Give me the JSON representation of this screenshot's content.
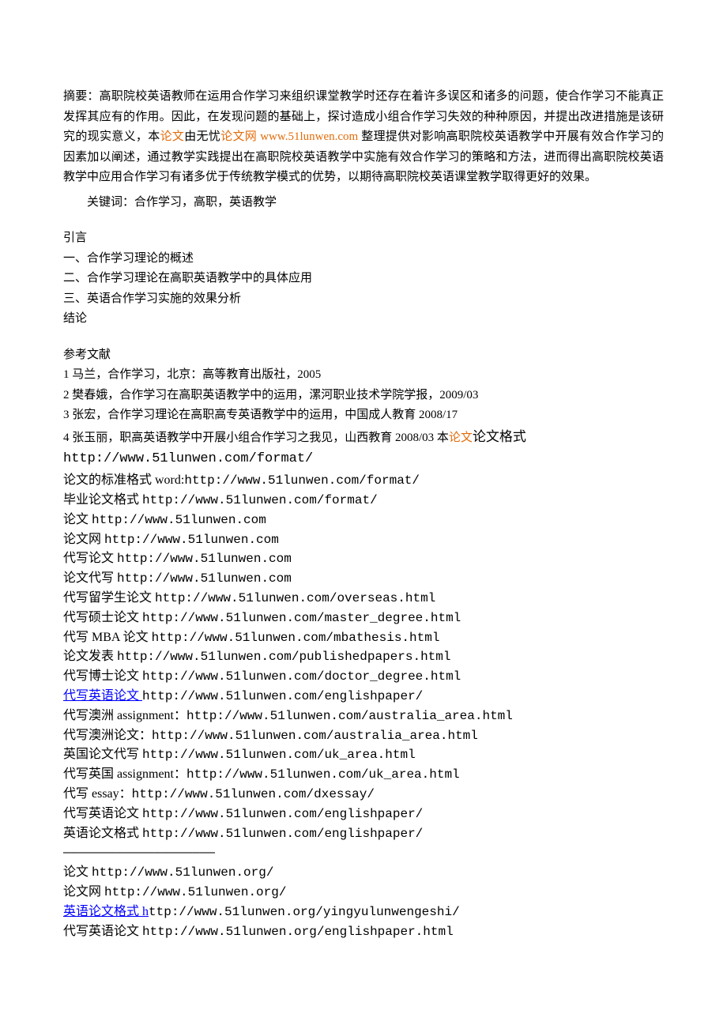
{
  "abstract": {
    "prefix": "  摘要：高职院校英语教师在运用合作学习来组织课堂教学时还存在着许多误区和诸多的问题，使合作学习不能真正发挥其应有的作用。因此，在发现问题的基础上，探讨造成小组合作学习失效的种种原因，并提出改进措施是该研究的现实意义，本",
    "link1": "论文",
    "mid1": "由无忧",
    "link2": "论文网 www.51lunwen.com ",
    "suffix": "整理提供对影响高职院校英语教学中开展有效合作学习的因素加以阐述，通过教学实践提出在高职院校英语教学中实施有效合作学习的策略和方法，进而得出高职院校英语教学中应用合作学习有诸多优于传统教学模式的优势，以期待高职院校英语课堂教学取得更好的效果。"
  },
  "keywords": "关键词：合作学习，高职，英语教学",
  "outline": {
    "l1": "引言",
    "l2": "一、合作学习理论的概述",
    "l3": "二、合作学习理论在高职英语教学中的具体应用",
    "l4": "三、英语合作学习实施的效果分析",
    "l5": "结论"
  },
  "refs_header": "参考文献",
  "refs": {
    "r1": "1 马兰，合作学习，北京：高等教育出版社，2005",
    "r2": "2 樊春娥，合作学习在高职英语教学中的运用，漯河职业技术学院学报，2009/03",
    "r3": "3 张宏，合作学习理论在高职高专英语教学中的运用，中国成人教育  2008/17",
    "r4p": "4 张玉丽，职高英语教学中开展小组合作学习之我见，山西教育  2008/03 本",
    "r4link": "论文",
    "r4suffix": "论文格式",
    "r4url": "http://www.51lunwen.com/format/"
  },
  "links": {
    "l1a": "论文的标准格式 word:",
    "l1b": "http://www.51lunwen.com/format/",
    "l2a": "毕业论文格式 ",
    "l2b": "http://www.51lunwen.com/format/",
    "l3a": "论文 ",
    "l3b": "http://www.51lunwen.com",
    "l4a": "论文网 ",
    "l4b": "http://www.51lunwen.com",
    "l5a": "代写论文 ",
    "l5b": "http://www.51lunwen.com",
    "l6a": "论文代写 ",
    "l6b": "http://www.51lunwen.com",
    "l7a": "代写留学生论文 ",
    "l7b": "http://www.51lunwen.com/overseas.html",
    "l8a": "代写硕士论文 ",
    "l8b": "http://www.51lunwen.com/master_degree.html",
    "l9a": "代写 MBA 论文 ",
    "l9b": "http://www.51lunwen.com/mbathesis.html",
    "l10a": "论文发表 ",
    "l10b": "http://www.51lunwen.com/publishedpapers.html",
    "l11a": "代写博士论文 ",
    "l11b": "http://www.51lunwen.com/doctor_degree.html",
    "l12a": "代写英语论文 ",
    "l12b": "http://www.51lunwen.com/englishpaper/",
    "l13a": "代写澳洲 assignment：",
    "l13b": "http://www.51lunwen.com/australia_area.html",
    "l14a": "代写澳洲论文：",
    "l14b": "http://www.51lunwen.com/australia_area.html",
    "l15a": "英国论文代写 ",
    "l15b": "http://www.51lunwen.com/uk_area.html",
    "l16a": "代写英国 assignment：",
    "l16b": "http://www.51lunwen.com/uk_area.html",
    "l17a": "代写 essay：",
    "l17b": "http://www.51lunwen.com/dxessay/",
    "l18a": "代写英语论文 ",
    "l18b": "http://www.51lunwen.com/englishpaper/",
    "l19a": "英语论文格式 ",
    "l19b": "http://www.51lunwen.com/englishpaper/",
    "sep": "————————————————————",
    "l20a": "论文 ",
    "l20b": "http://www.51lunwen.org/",
    "l21a": "论文网 ",
    "l21b": "http://www.51lunwen.org/",
    "l22a": "英语论文格式 h",
    "l22b": "ttp://www.51lunwen.org/yingyulunwengeshi/",
    "l23a": "代写英语论文 ",
    "l23b": "http://www.51lunwen.org/englishpaper.html"
  }
}
